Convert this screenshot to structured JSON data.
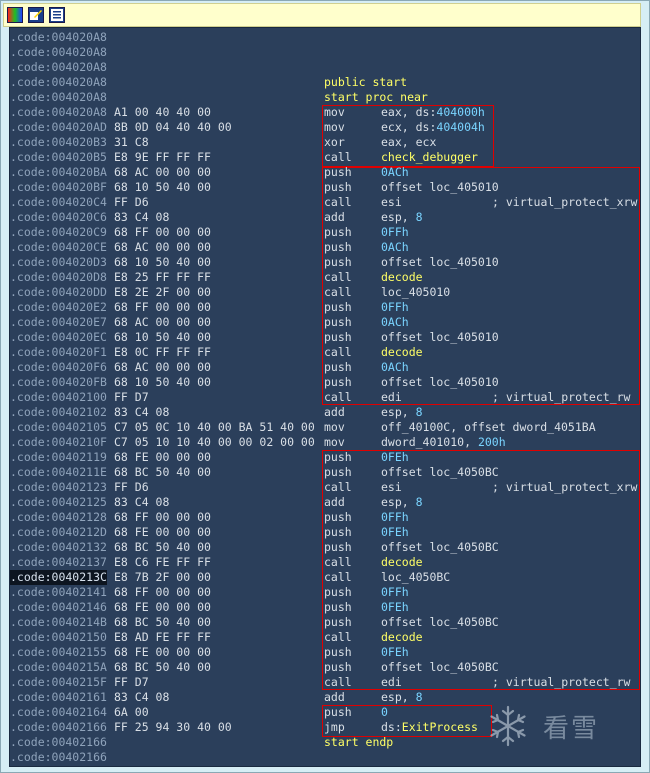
{
  "toolbar": {
    "buttons": [
      "graph-view-icon",
      "edit-icon",
      "text-view-icon"
    ]
  },
  "lines": [
    {
      "addr": ".code:004020A8",
      "bytes": "",
      "mnem": "",
      "ops": "",
      "cmt": ""
    },
    {
      "addr": ".code:004020A8",
      "bytes": "",
      "mnem": "",
      "ops": "",
      "cmt": ""
    },
    {
      "addr": ".code:004020A8",
      "bytes": "",
      "mnem": "",
      "ops": "",
      "cmt": ""
    },
    {
      "addr": ".code:004020A8",
      "bytes": "",
      "mnem": "",
      "ops": "",
      "cmt": "",
      "label": "public start"
    },
    {
      "addr": ".code:004020A8",
      "bytes": "",
      "mnem": "",
      "ops": "",
      "cmt": "",
      "label": "start proc near"
    },
    {
      "addr": ".code:004020A8",
      "bytes": "A1 00 40 40 00",
      "mnem": "mov",
      "ops_pre": "eax, ds:",
      "ops_c": "404000h",
      "cmt": ""
    },
    {
      "addr": ".code:004020AD",
      "bytes": "8B 0D 04 40 40 00",
      "mnem": "mov",
      "ops_pre": "ecx, ds:",
      "ops_c": "404004h",
      "cmt": ""
    },
    {
      "addr": ".code:004020B3",
      "bytes": "31 C8",
      "mnem": "xor",
      "ops": "eax, ecx",
      "cmt": ""
    },
    {
      "addr": ".code:004020B5",
      "bytes": "E8 9E FF FF FF",
      "mnem": "call",
      "ops_y": "check_debugger",
      "cmt": ""
    },
    {
      "addr": ".code:004020BA",
      "bytes": "68 AC 00 00 00",
      "mnem": "push",
      "ops_c": "0ACh",
      "cmt": ""
    },
    {
      "addr": ".code:004020BF",
      "bytes": "68 10 50 40 00",
      "mnem": "push",
      "ops": "offset loc_405010",
      "cmt": ""
    },
    {
      "addr": ".code:004020C4",
      "bytes": "FF D6",
      "mnem": "call",
      "ops": "esi",
      "cmt": "; virtual_protect_xrw"
    },
    {
      "addr": ".code:004020C6",
      "bytes": "83 C4 08",
      "mnem": "add",
      "ops_pre": "esp, ",
      "ops_c": "8",
      "cmt": ""
    },
    {
      "addr": ".code:004020C9",
      "bytes": "68 FF 00 00 00",
      "mnem": "push",
      "ops_c": "0FFh",
      "cmt": ""
    },
    {
      "addr": ".code:004020CE",
      "bytes": "68 AC 00 00 00",
      "mnem": "push",
      "ops_c": "0ACh",
      "cmt": ""
    },
    {
      "addr": ".code:004020D3",
      "bytes": "68 10 50 40 00",
      "mnem": "push",
      "ops": "offset loc_405010",
      "cmt": ""
    },
    {
      "addr": ".code:004020D8",
      "bytes": "E8 25 FF FF FF",
      "mnem": "call",
      "ops_y": "decode",
      "cmt": ""
    },
    {
      "addr": ".code:004020DD",
      "bytes": "E8 2E 2F 00 00",
      "mnem": "call",
      "ops": "loc_405010",
      "cmt": ""
    },
    {
      "addr": ".code:004020E2",
      "bytes": "68 FF 00 00 00",
      "mnem": "push",
      "ops_c": "0FFh",
      "cmt": ""
    },
    {
      "addr": ".code:004020E7",
      "bytes": "68 AC 00 00 00",
      "mnem": "push",
      "ops_c": "0ACh",
      "cmt": ""
    },
    {
      "addr": ".code:004020EC",
      "bytes": "68 10 50 40 00",
      "mnem": "push",
      "ops": "offset loc_405010",
      "cmt": ""
    },
    {
      "addr": ".code:004020F1",
      "bytes": "E8 0C FF FF FF",
      "mnem": "call",
      "ops_y": "decode",
      "cmt": ""
    },
    {
      "addr": ".code:004020F6",
      "bytes": "68 AC 00 00 00",
      "mnem": "push",
      "ops_c": "0ACh",
      "cmt": ""
    },
    {
      "addr": ".code:004020FB",
      "bytes": "68 10 50 40 00",
      "mnem": "push",
      "ops": "offset loc_405010",
      "cmt": ""
    },
    {
      "addr": ".code:00402100",
      "bytes": "FF D7",
      "mnem": "call",
      "ops": "edi",
      "cmt": "; virtual_protect_rw"
    },
    {
      "addr": ".code:00402102",
      "bytes": "83 C4 08",
      "mnem": "add",
      "ops_pre": "esp, ",
      "ops_c": "8",
      "cmt": ""
    },
    {
      "addr": ".code:00402105",
      "bytes": "C7 05 0C 10 40 00 BA 51 40 00",
      "mnem": "mov",
      "ops": "off_40100C, offset dword_4051BA",
      "cmt": ""
    },
    {
      "addr": ".code:0040210F",
      "bytes": "C7 05 10 10 40 00 00 02 00 00",
      "mnem": "mov",
      "ops_pre": "dword_401010, ",
      "ops_c": "200h",
      "cmt": ""
    },
    {
      "addr": ".code:00402119",
      "bytes": "68 FE 00 00 00",
      "mnem": "push",
      "ops_c": "0FEh",
      "cmt": ""
    },
    {
      "addr": ".code:0040211E",
      "bytes": "68 BC 50 40 00",
      "mnem": "push",
      "ops": "offset loc_4050BC",
      "cmt": ""
    },
    {
      "addr": ".code:00402123",
      "bytes": "FF D6",
      "mnem": "call",
      "ops": "esi",
      "cmt": "; virtual_protect_xrw"
    },
    {
      "addr": ".code:00402125",
      "bytes": "83 C4 08",
      "mnem": "add",
      "ops_pre": "esp, ",
      "ops_c": "8",
      "cmt": ""
    },
    {
      "addr": ".code:00402128",
      "bytes": "68 FF 00 00 00",
      "mnem": "push",
      "ops_c": "0FFh",
      "cmt": ""
    },
    {
      "addr": ".code:0040212D",
      "bytes": "68 FE 00 00 00",
      "mnem": "push",
      "ops_c": "0FEh",
      "cmt": ""
    },
    {
      "addr": ".code:00402132",
      "bytes": "68 BC 50 40 00",
      "mnem": "push",
      "ops": "offset loc_4050BC",
      "cmt": ""
    },
    {
      "addr": ".code:00402137",
      "bytes": "E8 C6 FE FF FF",
      "mnem": "call",
      "ops_y": "decode",
      "cmt": ""
    },
    {
      "addr": ".code:0040213C",
      "bytes": "E8 7B 2F 00 00",
      "mnem": "call",
      "ops": "loc_4050BC",
      "cmt": "",
      "addr_hl": true
    },
    {
      "addr": ".code:00402141",
      "bytes": "68 FF 00 00 00",
      "mnem": "push",
      "ops_c": "0FFh",
      "cmt": ""
    },
    {
      "addr": ".code:00402146",
      "bytes": "68 FE 00 00 00",
      "mnem": "push",
      "ops_c": "0FEh",
      "cmt": ""
    },
    {
      "addr": ".code:0040214B",
      "bytes": "68 BC 50 40 00",
      "mnem": "push",
      "ops": "offset loc_4050BC",
      "cmt": ""
    },
    {
      "addr": ".code:00402150",
      "bytes": "E8 AD FE FF FF",
      "mnem": "call",
      "ops_y": "decode",
      "cmt": ""
    },
    {
      "addr": ".code:00402155",
      "bytes": "68 FE 00 00 00",
      "mnem": "push",
      "ops_c": "0FEh",
      "cmt": ""
    },
    {
      "addr": ".code:0040215A",
      "bytes": "68 BC 50 40 00",
      "mnem": "push",
      "ops": "offset loc_4050BC",
      "cmt": ""
    },
    {
      "addr": ".code:0040215F",
      "bytes": "FF D7",
      "mnem": "call",
      "ops": "edi",
      "cmt": "; virtual_protect_rw"
    },
    {
      "addr": ".code:00402161",
      "bytes": "83 C4 08",
      "mnem": "add",
      "ops_pre": "esp, ",
      "ops_c": "8",
      "cmt": ""
    },
    {
      "addr": ".code:00402164",
      "bytes": "6A 00",
      "mnem": "push",
      "ops_c": "0",
      "cmt": ""
    },
    {
      "addr": ".code:00402166",
      "bytes": "FF 25 94 30 40 00",
      "mnem": "jmp",
      "ops_pre": "ds:",
      "ops_y": "ExitProcess",
      "cmt": ""
    },
    {
      "addr": ".code:00402166",
      "bytes": "",
      "mnem": "",
      "ops": "",
      "cmt": "",
      "label": "start endp"
    },
    {
      "addr": ".code:00402166",
      "bytes": "",
      "mnem": "",
      "ops": "",
      "cmt": ""
    }
  ],
  "highlight_boxes": [
    "block-1",
    "block-2",
    "block-3",
    "block-4"
  ],
  "watermark": {
    "text": "看雪",
    "icon": "snowflake-icon"
  },
  "colors": {
    "background": "#2b3f5b",
    "address": "#8fa3bb",
    "text": "#d9dfe6",
    "name": "#ffff66",
    "constant": "#7ad4ff",
    "box": "#e00000",
    "toolbar": "#ffffcc"
  }
}
